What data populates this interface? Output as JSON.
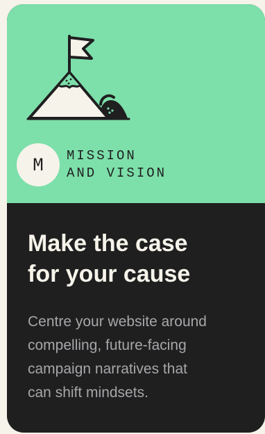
{
  "card": {
    "badge_letter": "M",
    "eyebrow": [
      "MISSION",
      "AND VISION"
    ],
    "headline": [
      "Make the case",
      "for your cause"
    ],
    "description": [
      "Centre your website around",
      "compelling, future-facing",
      "campaign narratives that",
      "can shift mindsets."
    ],
    "colors": {
      "accent": "#7ddfaa",
      "card_background": "#1f1f20",
      "page_background": "#f6f3ea",
      "headline": "#f6f3ea",
      "body": "#a7a7aa"
    },
    "illustration": "mountain-flag-icon"
  }
}
